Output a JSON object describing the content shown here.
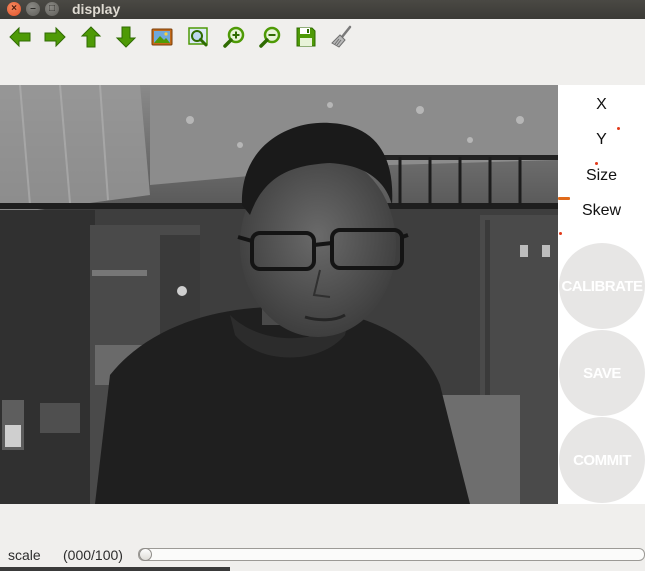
{
  "window": {
    "title": "display",
    "controls": {
      "close": "×",
      "minimize": "–",
      "maximize": "□"
    }
  },
  "toolbar": {
    "buttons": [
      {
        "name": "left-arrow-icon"
      },
      {
        "name": "right-arrow-icon"
      },
      {
        "name": "up-arrow-icon"
      },
      {
        "name": "down-arrow-icon"
      },
      {
        "name": "picture-icon"
      },
      {
        "name": "zoom-fit-icon"
      },
      {
        "name": "zoom-in-icon"
      },
      {
        "name": "zoom-out-icon"
      },
      {
        "name": "save-disk-icon"
      },
      {
        "name": "broom-icon"
      }
    ]
  },
  "side_panel": {
    "x_label": "X",
    "y_label": "Y",
    "size_label": "Size",
    "skew_label": "Skew",
    "calibrate_label": "CALIBRATE",
    "save_label": "SAVE",
    "commit_label": "COMMIT"
  },
  "scale": {
    "label": "scale",
    "value_text": "(000/100)",
    "value": 0,
    "max": 100
  },
  "colors": {
    "icon_green": "#4e9a06",
    "mark_red": "#e23a1a",
    "button_gray": "#e7e6e5"
  }
}
